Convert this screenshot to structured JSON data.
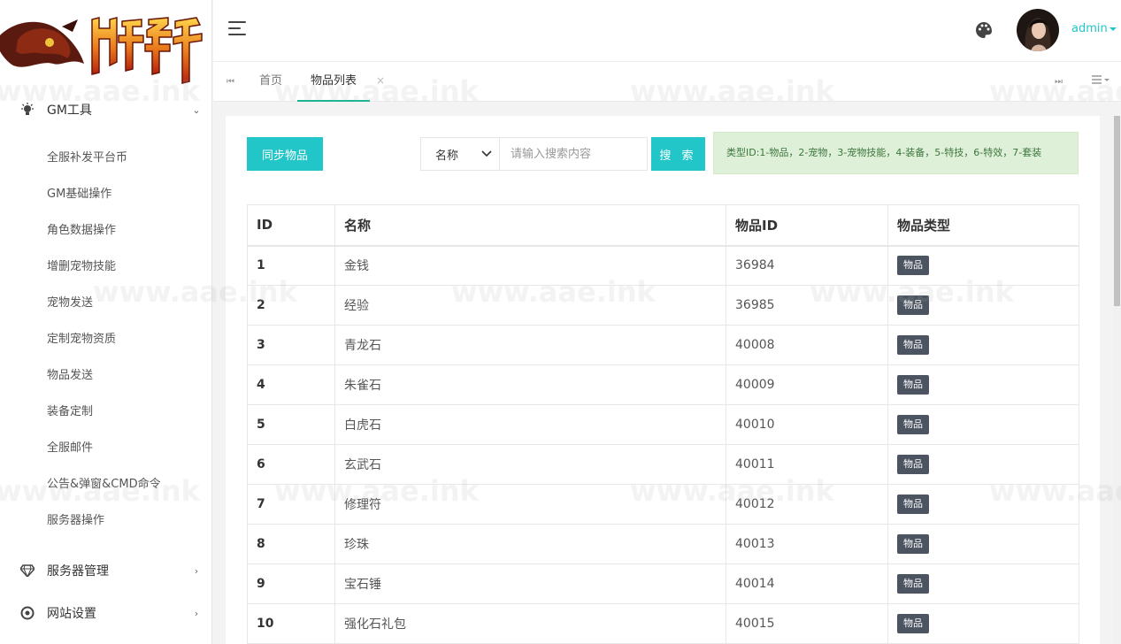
{
  "sidebar": {
    "groups": [
      {
        "label": "GM工具",
        "icon": "lightbulb-icon",
        "expanded": true,
        "items": [
          {
            "label": "全服补发平台币"
          },
          {
            "label": "GM基础操作"
          },
          {
            "label": "角色数据操作"
          },
          {
            "label": "增删宠物技能"
          },
          {
            "label": "宠物发送"
          },
          {
            "label": "定制宠物资质"
          },
          {
            "label": "物品发送"
          },
          {
            "label": "装备定制"
          },
          {
            "label": "全服邮件"
          },
          {
            "label": "公告&弹窗&CMD命令"
          },
          {
            "label": "服务器操作"
          }
        ]
      },
      {
        "label": "服务器管理",
        "icon": "diamond-icon",
        "expanded": false
      },
      {
        "label": "网站设置",
        "icon": "settings-icon",
        "expanded": false
      }
    ]
  },
  "header": {
    "user": "admin"
  },
  "tabs": [
    {
      "label": "首页",
      "active": false
    },
    {
      "label": "物品列表",
      "active": true
    }
  ],
  "toolbar": {
    "sync_label": "同步物品",
    "select_value": "名称",
    "search_placeholder": "请输入搜索内容",
    "search_label": "搜 索",
    "notice": "类型ID:1-物品，2-宠物，3-宠物技能，4-装备，5-特技，6-特效，7-套装"
  },
  "table": {
    "columns": [
      "ID",
      "名称",
      "物品ID",
      "物品类型"
    ],
    "rows": [
      {
        "id": "1",
        "name": "金钱",
        "item_id": "36984",
        "type": "物品"
      },
      {
        "id": "2",
        "name": "经验",
        "item_id": "36985",
        "type": "物品"
      },
      {
        "id": "3",
        "name": "青龙石",
        "item_id": "40008",
        "type": "物品"
      },
      {
        "id": "4",
        "name": "朱雀石",
        "item_id": "40009",
        "type": "物品"
      },
      {
        "id": "5",
        "name": "白虎石",
        "item_id": "40010",
        "type": "物品"
      },
      {
        "id": "6",
        "name": "玄武石",
        "item_id": "40011",
        "type": "物品"
      },
      {
        "id": "7",
        "name": "修理符",
        "item_id": "40012",
        "type": "物品"
      },
      {
        "id": "8",
        "name": "珍珠",
        "item_id": "40013",
        "type": "物品"
      },
      {
        "id": "9",
        "name": "宝石锤",
        "item_id": "40014",
        "type": "物品"
      },
      {
        "id": "10",
        "name": "强化石礼包",
        "item_id": "40015",
        "type": "物品"
      }
    ]
  },
  "watermark": "www.aae.ink",
  "colors": {
    "accent": "#23c6c8",
    "badge": "#4b5460",
    "notice_bg": "#dff0d8",
    "notice_text": "#3c763d"
  }
}
